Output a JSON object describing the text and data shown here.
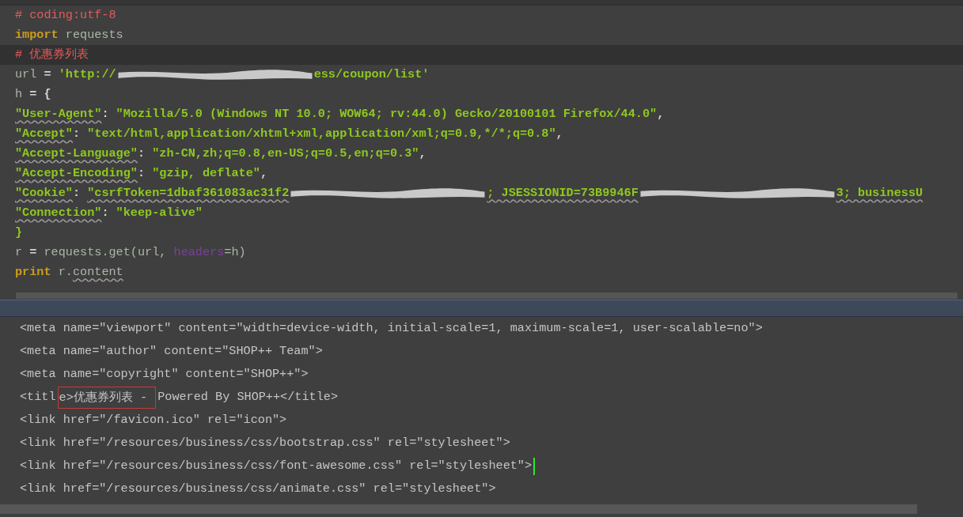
{
  "editor": {
    "lines": [
      {
        "current": false,
        "segments": [
          {
            "kind": "text",
            "tokens": [
              {
                "kind": "comment",
                "text": "# coding:utf-8"
              }
            ]
          }
        ]
      },
      {
        "current": false,
        "segments": [
          {
            "kind": "text",
            "tokens": [
              {
                "kind": "keyword",
                "text": "import"
              },
              {
                "kind": "ident",
                "text": " requests"
              }
            ]
          }
        ]
      },
      {
        "current": true,
        "segments": [
          {
            "kind": "text",
            "tokens": [
              {
                "kind": "comment",
                "text": "# 优惠券列表"
              }
            ]
          }
        ]
      },
      {
        "current": false,
        "segments": [
          {
            "kind": "text",
            "tokens": [
              {
                "kind": "ident",
                "text": "url "
              },
              {
                "kind": "op",
                "text": "= "
              },
              {
                "kind": "string",
                "text": "'http://"
              }
            ]
          },
          {
            "kind": "redacted"
          },
          {
            "kind": "text",
            "tokens": [
              {
                "kind": "string",
                "text": "ess/coupon/list'"
              }
            ]
          }
        ]
      },
      {
        "current": false,
        "segments": [
          {
            "kind": "text",
            "tokens": [
              {
                "kind": "ident",
                "text": "h "
              },
              {
                "kind": "op",
                "text": "= {"
              }
            ]
          }
        ]
      },
      {
        "current": false,
        "segments": [
          {
            "kind": "text",
            "tokens": [
              {
                "kind": "key",
                "text": "\"User-Agent\""
              },
              {
                "kind": "op",
                "text": ": "
              },
              {
                "kind": "string",
                "text": "\"Mozilla/5.0 (Windows NT 10.0; WOW64; rv:44.0) Gecko/20100101 Firefox/44.0\""
              },
              {
                "kind": "op",
                "text": ","
              }
            ]
          }
        ]
      },
      {
        "current": false,
        "segments": [
          {
            "kind": "text",
            "tokens": [
              {
                "kind": "key",
                "text": "\"Accept\""
              },
              {
                "kind": "op",
                "text": ": "
              },
              {
                "kind": "string",
                "text": "\"text/html,application/xhtml+xml,application/xml;q=0.9,*/*;q=0.8\""
              },
              {
                "kind": "op",
                "text": ","
              }
            ]
          }
        ]
      },
      {
        "current": false,
        "segments": [
          {
            "kind": "text",
            "tokens": [
              {
                "kind": "key",
                "text": "\"Accept-Language\""
              },
              {
                "kind": "op",
                "text": ": "
              },
              {
                "kind": "string",
                "text": "\"zh-CN,zh;q=0.8,en-US;q=0.5,en;q=0.3\""
              },
              {
                "kind": "op",
                "text": ","
              }
            ]
          }
        ]
      },
      {
        "current": false,
        "segments": [
          {
            "kind": "text",
            "tokens": [
              {
                "kind": "key",
                "text": "\"Accept-Encoding\""
              },
              {
                "kind": "op",
                "text": ": "
              },
              {
                "kind": "string",
                "text": "\"gzip, deflate\""
              },
              {
                "kind": "op",
                "text": ","
              }
            ]
          }
        ]
      },
      {
        "current": false,
        "segments": [
          {
            "kind": "text",
            "tokens": [
              {
                "kind": "key",
                "text": "\"Cookie\""
              },
              {
                "kind": "op",
                "text": ": "
              },
              {
                "kind": "string_warn",
                "text": "\"csrfToken=1dbaf361083ac31f2"
              }
            ]
          },
          {
            "kind": "redacted"
          },
          {
            "kind": "text",
            "tokens": [
              {
                "kind": "string_warn",
                "text": "; JSESSIONID=73B9946F"
              }
            ]
          },
          {
            "kind": "redacted"
          },
          {
            "kind": "text",
            "tokens": [
              {
                "kind": "string_warn",
                "text": "3; businessU"
              }
            ]
          }
        ]
      },
      {
        "current": false,
        "segments": [
          {
            "kind": "text",
            "tokens": [
              {
                "kind": "key",
                "text": "\"Connection\""
              },
              {
                "kind": "op",
                "text": ": "
              },
              {
                "kind": "string",
                "text": "\"keep-alive\""
              }
            ]
          }
        ]
      },
      {
        "current": false,
        "segments": [
          {
            "kind": "text",
            "tokens": [
              {
                "kind": "string",
                "text": "}"
              }
            ]
          }
        ]
      },
      {
        "current": false,
        "segments": [
          {
            "kind": "text",
            "tokens": [
              {
                "kind": "ident",
                "text": "r "
              },
              {
                "kind": "op",
                "text": "= "
              },
              {
                "kind": "ident",
                "text": "requests.get(url, "
              },
              {
                "kind": "param",
                "text": "headers"
              },
              {
                "kind": "ident",
                "text": "=h)"
              }
            ]
          }
        ]
      },
      {
        "current": false,
        "segments": [
          {
            "kind": "text",
            "tokens": [
              {
                "kind": "keyword",
                "text": "print"
              },
              {
                "kind": "ident",
                "text": " r."
              },
              {
                "kind": "warn",
                "text": "content"
              }
            ]
          }
        ]
      }
    ]
  },
  "output": {
    "lines": [
      {
        "cursor": false,
        "segments": [
          {
            "kind": "text",
            "text": "<meta name=\"viewport\" content=\"width=device-width, initial-scale=1, maximum-scale=1, user-scalable=no\">"
          }
        ]
      },
      {
        "cursor": false,
        "segments": [
          {
            "kind": "text",
            "text": "<meta name=\"author\" content=\"SHOP++ Team\">"
          }
        ]
      },
      {
        "cursor": false,
        "segments": [
          {
            "kind": "text",
            "text": "<meta name=\"copyright\" content=\"SHOP++\">"
          }
        ]
      },
      {
        "cursor": false,
        "segments": [
          {
            "kind": "text",
            "text": "<titl"
          },
          {
            "kind": "boxed",
            "text": "e>优惠券列表 - "
          },
          {
            "kind": "text",
            "text": "Powered By SHOP++</title>"
          }
        ]
      },
      {
        "cursor": false,
        "segments": [
          {
            "kind": "text",
            "text": "<link href=\"/favicon.ico\" rel=\"icon\">"
          }
        ]
      },
      {
        "cursor": false,
        "segments": [
          {
            "kind": "text",
            "text": "<link href=\"/resources/business/css/bootstrap.css\" rel=\"stylesheet\">"
          }
        ]
      },
      {
        "cursor": true,
        "segments": [
          {
            "kind": "text",
            "text": "<link href=\"/resources/business/css/font-awesome.css\" rel=\"stylesheet\">"
          }
        ]
      },
      {
        "cursor": false,
        "segments": [
          {
            "kind": "text",
            "text": "<link href=\"/resources/business/css/animate.css\" rel=\"stylesheet\">"
          }
        ]
      }
    ]
  }
}
